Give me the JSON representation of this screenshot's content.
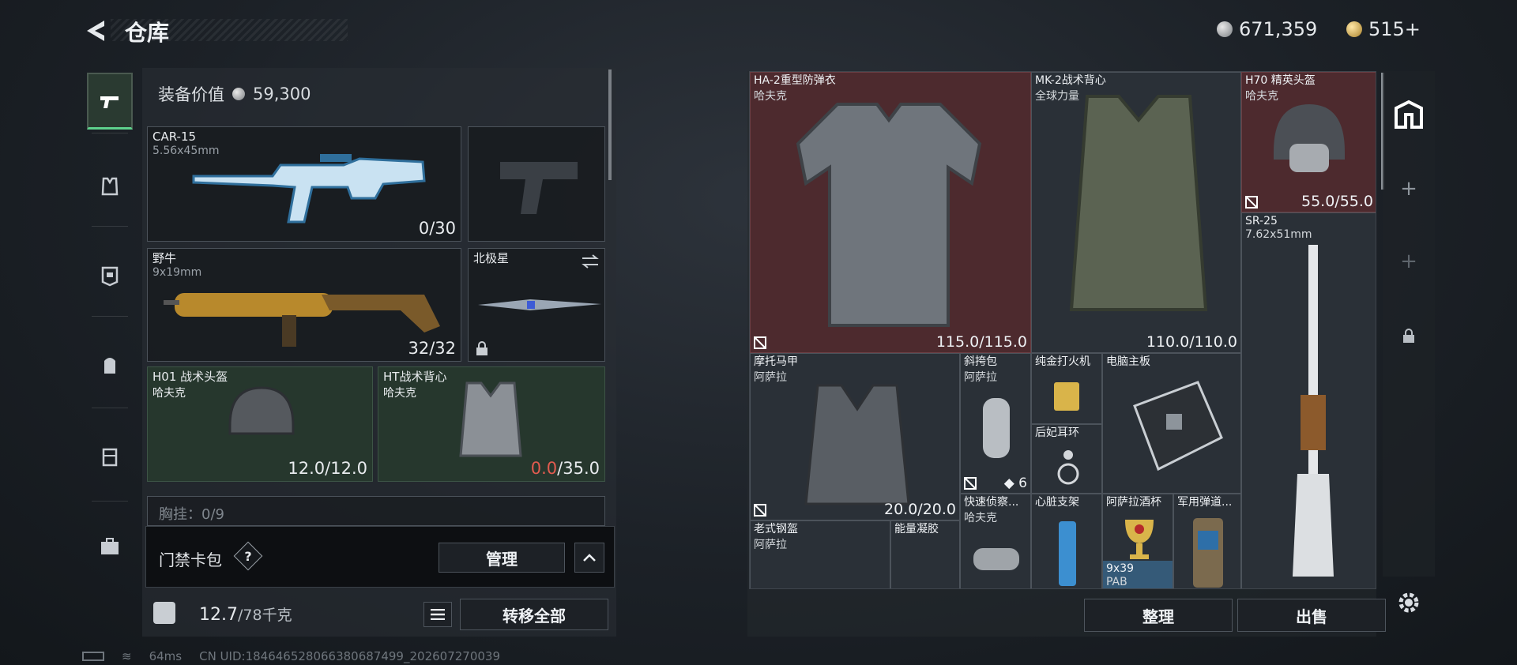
{
  "header": {
    "title": "仓库",
    "silver_amount": "671,359",
    "gold_amount": "515+"
  },
  "sidebar": {
    "tabs": [
      "pistol-icon",
      "vest-icon",
      "armor-icon",
      "backpack-icon",
      "rig-icon",
      "case-icon"
    ]
  },
  "loadout": {
    "equip_label": "装备价值",
    "equip_value": "59,300",
    "primary": {
      "name": "CAR-15",
      "caliber": "5.56x45mm",
      "ammo": "0/30"
    },
    "secondary_empty": "",
    "weapon2": {
      "name": "野牛",
      "caliber": "9x19mm",
      "ammo": "32/32"
    },
    "melee": {
      "name": "北极星"
    },
    "helmet": {
      "name": "H01 战术头盔",
      "brand": "哈夫克",
      "dur": "12.0/12.0"
    },
    "vest": {
      "name": "HT战术背心",
      "brand": "哈夫克",
      "dur_current": "0.0",
      "dur_max": "/35.0"
    },
    "chest_rig": "胸挂：0/9",
    "keybag_label": "门禁卡包",
    "keybag_help": "?",
    "manage_label": "管理",
    "weight_current": "12.7",
    "weight_max": "/78千克",
    "transfer_all": "转移全部"
  },
  "stash": {
    "items": [
      {
        "name": "HA-2重型防弹衣",
        "brand": "哈夫克",
        "dur": "115.0/115.0"
      },
      {
        "name": "MK-2战术背心",
        "brand": "全球力量",
        "dur": "110.0/110.0"
      },
      {
        "name": "H70 精英头盔",
        "brand": "哈夫克",
        "dur": "55.0/55.0"
      },
      {
        "name": "SR-25",
        "brand": "7.62x51mm"
      },
      {
        "name": "摩托马甲",
        "brand": "阿萨拉",
        "dur": "20.0/20.0"
      },
      {
        "name": "斜挎包",
        "brand": "阿萨拉",
        "count": "6"
      },
      {
        "name": "纯金打火机"
      },
      {
        "name": "电脑主板"
      },
      {
        "name": "后妃耳环"
      },
      {
        "name": "快速侦察...",
        "brand": "哈夫克"
      },
      {
        "name": "心脏支架"
      },
      {
        "name": "阿萨拉酒杯"
      },
      {
        "name": "军用弹道..."
      },
      {
        "name": "老式钢盔",
        "brand": "阿萨拉"
      },
      {
        "name": "能量凝胶"
      },
      {
        "name": "9x39",
        "brand": "PAB"
      }
    ],
    "sort_label": "整理",
    "sell_label": "出售"
  },
  "status": {
    "ping": "64ms",
    "uid": "CN UID:184646528066380687499_202607270039"
  }
}
